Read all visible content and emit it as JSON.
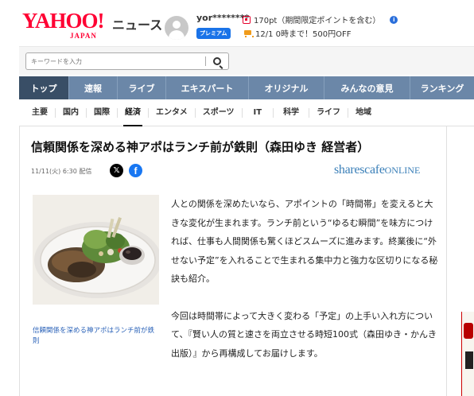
{
  "header": {
    "logo_main": "YAHOO!",
    "logo_sub": "JAPAN",
    "section": "ニュース",
    "username": "yor********",
    "premium_badge": "プレミアム",
    "points": "170pt（期間限定ポイントを含む）",
    "cart_promo": "12/1 0時まで！500円OFF"
  },
  "search": {
    "placeholder": "キーワードを入力"
  },
  "main_nav": [
    {
      "label": "トップ"
    },
    {
      "label": "速報"
    },
    {
      "label": "ライブ"
    },
    {
      "label": "エキスパート"
    },
    {
      "label": "オリジナル"
    },
    {
      "label": "みんなの意見"
    },
    {
      "label": "ランキング"
    }
  ],
  "sub_nav": [
    {
      "label": "主要"
    },
    {
      "label": "国内"
    },
    {
      "label": "国際"
    },
    {
      "label": "経済"
    },
    {
      "label": "エンタメ"
    },
    {
      "label": "スポーツ"
    },
    {
      "label": "IT"
    },
    {
      "label": "科学"
    },
    {
      "label": "ライフ"
    },
    {
      "label": "地域"
    }
  ],
  "article": {
    "title": "信頼関係を深める神アポはランチ前が鉄則（森田ゆき 経営者）",
    "date": "11/11(火) 6:30 配信",
    "x_label": "𝕏",
    "fb_label": "f",
    "source": "sharescafe",
    "source_suffix": "ONLINE",
    "caption": "信頼関係を深める神アポはランチ前が鉄則",
    "paragraphs": [
      "人との関係を深めたいなら、アポイントの「時間帯」を変えると大きな変化が生まれます。ランチ前という“ゆるむ瞬間”を味方につければ、仕事も人間関係も驚くほどスムーズに進みます。終業後に“外せない予定”を入れることで生まれる集中力と強力な区切りになる秘訣も紹介。",
      "今回は時間帯によって大きく変わる「予定」の上手い入れ方について、『賢い人の質と速さを両立させる時短100式（森田ゆき・かんき出版）』から再構成してお届けします。"
    ]
  }
}
